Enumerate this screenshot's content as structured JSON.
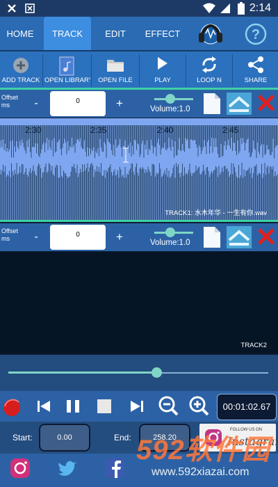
{
  "status": {
    "time": "2:14"
  },
  "tabs": [
    {
      "label": "HOME",
      "active": false
    },
    {
      "label": "TRACK",
      "active": true
    },
    {
      "label": "EDIT",
      "active": false
    },
    {
      "label": "EFFECT",
      "active": false
    }
  ],
  "toolbar": {
    "add_track": "ADD TRACK",
    "open_library": "OPEN LIBRARY",
    "open_file": "OPEN FILE",
    "play": "PLAY",
    "loop": "LOOP N",
    "share": "SHARE"
  },
  "track1": {
    "offset_label": "Offset",
    "offset_unit": "ms",
    "minus": "-",
    "plus": "+",
    "offset_value": "0",
    "volume_label": "Volume:1.0",
    "time_markers": [
      "2:30",
      "2:35",
      "2:40",
      "2:45"
    ],
    "name": "TRACK1: 水木年华 - 一生有你.wav"
  },
  "track2": {
    "offset_label": "Offset",
    "offset_unit": "ms",
    "minus": "-",
    "plus": "+",
    "offset_value": "0",
    "volume_label": "Volume:1.0",
    "name": "TRACK2"
  },
  "playback": {
    "progress": 0.57,
    "timer": "00:01:02.67"
  },
  "range": {
    "start_label": "Start:",
    "start_value": "0.00",
    "end_label": "End:",
    "end_value": "258.20"
  },
  "instagram_card": {
    "follow": "FOLLOW US ON",
    "brand": "Instagram"
  },
  "watermark": {
    "big": "592软件园",
    "small": "www.592xiazai.com"
  },
  "colors": {
    "accent": "#3fd1a5",
    "toolbar": "#2b71bd",
    "wave": "#7fa6f0"
  }
}
